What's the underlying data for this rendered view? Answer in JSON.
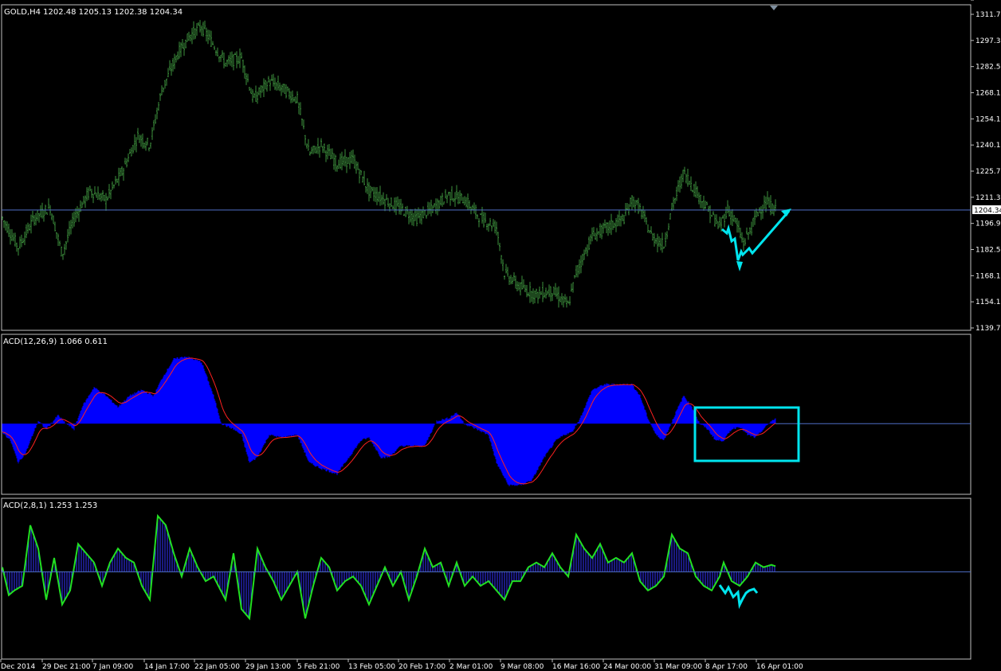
{
  "panes": {
    "price": {
      "label": "GOLD,H4  1202.48 1205.13 1202.38 1204.34",
      "current_price": "1204.34",
      "ticks": [
        "1311.70",
        "1297.30",
        "1282.50",
        "1268.10",
        "1254.10",
        "1240.10",
        "1225.70",
        "1211.30",
        "1196.90",
        "1182.50",
        "1168.10",
        "1154.10",
        "1139.70"
      ]
    },
    "acd1": {
      "label": "ACD(12,26,9) 1.066 0.611",
      "ticks": [
        "15.089",
        "0.00",
        "-11.893"
      ]
    },
    "acd2": {
      "label": "ACD(2,8,1) 1.253 1.253",
      "ticks": [
        "14.764",
        "0.00",
        "-17.694"
      ]
    },
    "time_axis": [
      "Dec 2014",
      "29 Dec 21:00",
      "7 Jan 09:00",
      "14 Jan 17:00",
      "22 Jan 05:00",
      "29 Jan 13:00",
      "5 Feb 21:00",
      "13 Feb 05:00",
      "20 Feb 17:00",
      "2 Mar 01:00",
      "9 Mar 08:00",
      "16 Mar 16:00",
      "24 Mar 00:00",
      "31 Mar 09:00",
      "8 Apr 17:00",
      "16 Apr 01:00"
    ]
  },
  "colors": {
    "background": "#000000",
    "bars": "#3d8f3d",
    "axis_text": "#ffffff",
    "price_line": "#4f6fc8",
    "acd1_hist": "#0000ff",
    "acd1_signal": "#ff2020",
    "acd2_hist": "#3333ff",
    "acd2_line": "#22e022",
    "annotation": "#00e5ee"
  },
  "chart_data": [
    {
      "type": "line",
      "title": "GOLD,H4",
      "series": [
        {
          "name": "GOLD,H4",
          "anchors": [
            [
              0,
              1200
            ],
            [
              20,
              1184
            ],
            [
              40,
              1200
            ],
            [
              60,
              1206
            ],
            [
              75,
              1180
            ],
            [
              90,
              1200
            ],
            [
              110,
              1215
            ],
            [
              130,
              1210
            ],
            [
              150,
              1225
            ],
            [
              170,
              1245
            ],
            [
              185,
              1240
            ],
            [
              200,
              1270
            ],
            [
              220,
              1290
            ],
            [
              235,
              1300
            ],
            [
              250,
              1305
            ],
            [
              265,
              1295
            ],
            [
              280,
              1285
            ],
            [
              300,
              1288
            ],
            [
              315,
              1265
            ],
            [
              335,
              1275
            ],
            [
              355,
              1270
            ],
            [
              370,
              1265
            ],
            [
              385,
              1235
            ],
            [
              400,
              1240
            ],
            [
              420,
              1230
            ],
            [
              440,
              1232
            ],
            [
              460,
              1215
            ],
            [
              480,
              1210
            ],
            [
              500,
              1205
            ],
            [
              520,
              1200
            ],
            [
              540,
              1205
            ],
            [
              560,
              1213
            ],
            [
              580,
              1210
            ],
            [
              600,
              1200
            ],
            [
              620,
              1195
            ],
            [
              630,
              1170
            ],
            [
              650,
              1162
            ],
            [
              670,
              1158
            ],
            [
              690,
              1160
            ],
            [
              710,
              1152
            ],
            [
              720,
              1170
            ],
            [
              740,
              1190
            ],
            [
              760,
              1195
            ],
            [
              780,
              1200
            ],
            [
              790,
              1210
            ],
            [
              800,
              1205
            ],
            [
              815,
              1190
            ],
            [
              830,
              1185
            ],
            [
              840,
              1205
            ],
            [
              855,
              1225
            ],
            [
              870,
              1215
            ],
            [
              885,
              1205
            ],
            [
              900,
              1195
            ],
            [
              910,
              1205
            ],
            [
              920,
              1198
            ],
            [
              930,
              1186
            ],
            [
              940,
              1195
            ],
            [
              950,
              1205
            ],
            [
              960,
              1208
            ],
            [
              970,
              1204
            ]
          ]
        }
      ],
      "ylim": [
        1139.7,
        1311.7
      ]
    },
    {
      "type": "bar",
      "title": "ACD(12,26,9)",
      "series": [
        {
          "name": "ACD(12,26,9)",
          "anchors": [
            [
              0,
              -1.5
            ],
            [
              10,
              -3
            ],
            [
              20,
              -7
            ],
            [
              30,
              -5
            ],
            [
              45,
              0.5
            ],
            [
              55,
              -1
            ],
            [
              70,
              1.5
            ],
            [
              80,
              0
            ],
            [
              90,
              -1
            ],
            [
              100,
              3
            ],
            [
              115,
              6.5
            ],
            [
              130,
              5
            ],
            [
              145,
              3
            ],
            [
              160,
              5
            ],
            [
              175,
              6
            ],
            [
              190,
              5
            ],
            [
              200,
              8
            ],
            [
              215,
              11.5
            ],
            [
              230,
              12
            ],
            [
              250,
              11
            ],
            [
              265,
              5
            ],
            [
              275,
              0
            ],
            [
              290,
              -1
            ],
            [
              300,
              -2
            ],
            [
              310,
              -7
            ],
            [
              320,
              -6
            ],
            [
              335,
              -2
            ],
            [
              350,
              -2.5
            ],
            [
              370,
              -2
            ],
            [
              385,
              -7
            ],
            [
              400,
              -8
            ],
            [
              420,
              -9
            ],
            [
              435,
              -6
            ],
            [
              450,
              -3
            ],
            [
              460,
              -2.5
            ],
            [
              475,
              -6
            ],
            [
              485,
              -6
            ],
            [
              500,
              -4
            ],
            [
              515,
              -4
            ],
            [
              530,
              -4
            ],
            [
              545,
              0.5
            ],
            [
              560,
              1
            ],
            [
              570,
              2
            ],
            [
              580,
              0
            ],
            [
              595,
              -1
            ],
            [
              610,
              -2
            ],
            [
              620,
              -7
            ],
            [
              635,
              -11
            ],
            [
              650,
              -11
            ],
            [
              665,
              -10
            ],
            [
              680,
              -6
            ],
            [
              695,
              -3
            ],
            [
              705,
              -2
            ],
            [
              715,
              -1.5
            ],
            [
              725,
              1
            ],
            [
              740,
              6
            ],
            [
              755,
              7
            ],
            [
              770,
              7
            ],
            [
              790,
              7
            ],
            [
              800,
              5
            ],
            [
              810,
              1
            ],
            [
              820,
              -2
            ],
            [
              830,
              -3
            ],
            [
              845,
              2
            ],
            [
              855,
              5
            ],
            [
              865,
              3
            ],
            [
              875,
              0
            ],
            [
              885,
              -1
            ],
            [
              895,
              -3
            ],
            [
              905,
              -3
            ],
            [
              915,
              -1
            ],
            [
              925,
              -0.5
            ],
            [
              935,
              -2
            ],
            [
              945,
              -2.5
            ],
            [
              955,
              -1
            ],
            [
              965,
              0.5
            ],
            [
              970,
              0.8
            ]
          ]
        }
      ],
      "ylim": [
        -11.893,
        15.089
      ]
    },
    {
      "type": "bar",
      "title": "ACD(2,8,1)",
      "series": [
        {
          "name": "ACD(2,8,1)",
          "anchors": [
            [
              0,
              1
            ],
            [
              8,
              -5
            ],
            [
              15,
              -4
            ],
            [
              25,
              -3
            ],
            [
              35,
              10
            ],
            [
              45,
              5
            ],
            [
              55,
              -6
            ],
            [
              65,
              3
            ],
            [
              75,
              -7
            ],
            [
              85,
              -4
            ],
            [
              95,
              6
            ],
            [
              105,
              4
            ],
            [
              115,
              2
            ],
            [
              125,
              -3
            ],
            [
              135,
              2
            ],
            [
              145,
              5
            ],
            [
              155,
              3
            ],
            [
              165,
              2
            ],
            [
              175,
              -3
            ],
            [
              185,
              -6
            ],
            [
              195,
              12
            ],
            [
              205,
              10
            ],
            [
              215,
              4
            ],
            [
              225,
              -1
            ],
            [
              235,
              5
            ],
            [
              245,
              1
            ],
            [
              255,
              -2
            ],
            [
              265,
              -1
            ],
            [
              280,
              -6
            ],
            [
              290,
              4
            ],
            [
              300,
              -8
            ],
            [
              310,
              -10
            ],
            [
              320,
              5
            ],
            [
              330,
              1
            ],
            [
              340,
              -2
            ],
            [
              350,
              -6
            ],
            [
              360,
              -3
            ],
            [
              370,
              0
            ],
            [
              380,
              -10
            ],
            [
              390,
              -3
            ],
            [
              400,
              3
            ],
            [
              410,
              1
            ],
            [
              420,
              -4
            ],
            [
              430,
              -2
            ],
            [
              440,
              -1
            ],
            [
              450,
              -3
            ],
            [
              460,
              -7
            ],
            [
              470,
              -3
            ],
            [
              480,
              1
            ],
            [
              490,
              -3
            ],
            [
              500,
              0
            ],
            [
              510,
              -6
            ],
            [
              520,
              -1
            ],
            [
              530,
              5
            ],
            [
              540,
              1
            ],
            [
              550,
              2
            ],
            [
              560,
              -3
            ],
            [
              570,
              2
            ],
            [
              580,
              -3
            ],
            [
              590,
              -1
            ],
            [
              600,
              -3
            ],
            [
              610,
              -2
            ],
            [
              620,
              -4
            ],
            [
              630,
              -6
            ],
            [
              640,
              -2
            ],
            [
              650,
              -2
            ],
            [
              660,
              1
            ],
            [
              670,
              2
            ],
            [
              680,
              1
            ],
            [
              690,
              4
            ],
            [
              700,
              1
            ],
            [
              710,
              -1
            ],
            [
              720,
              8
            ],
            [
              730,
              5
            ],
            [
              740,
              3
            ],
            [
              750,
              6
            ],
            [
              760,
              2
            ],
            [
              770,
              3
            ],
            [
              780,
              2
            ],
            [
              790,
              4
            ],
            [
              800,
              -2
            ],
            [
              810,
              -4
            ],
            [
              820,
              -3
            ],
            [
              830,
              -1
            ],
            [
              840,
              8
            ],
            [
              850,
              5
            ],
            [
              860,
              4
            ],
            [
              870,
              -1
            ],
            [
              880,
              -3
            ],
            [
              890,
              -4
            ],
            [
              900,
              -1
            ],
            [
              905,
              2
            ],
            [
              915,
              -2
            ],
            [
              925,
              -3
            ],
            [
              935,
              -1
            ],
            [
              945,
              2
            ],
            [
              955,
              1
            ],
            [
              965,
              1.5
            ],
            [
              970,
              1.2
            ]
          ]
        }
      ],
      "ylim": [
        -17.694,
        14.764
      ]
    }
  ]
}
